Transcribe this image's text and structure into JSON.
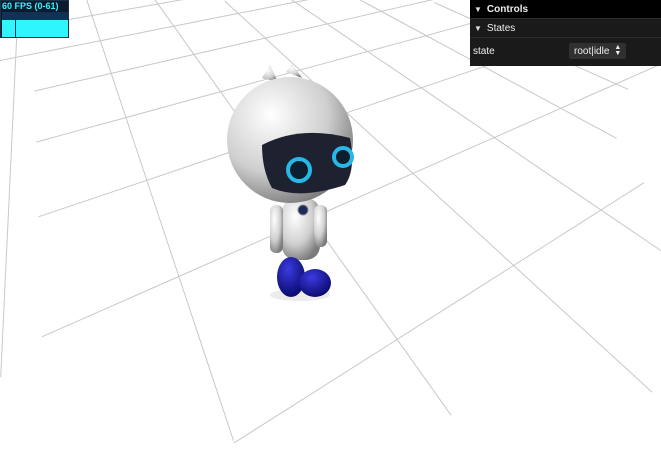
{
  "stats": {
    "fps_label": "60 FPS (0-61)"
  },
  "gui": {
    "controls_title": "Controls",
    "states_title": "States",
    "state_label": "state",
    "state_value": "root|idle"
  },
  "colors": {
    "fps_accent": "#2ff5ff",
    "grid": "#c8c8c8",
    "robot_feet": "#1a1a9a",
    "robot_eyes": "#27b8e8"
  }
}
